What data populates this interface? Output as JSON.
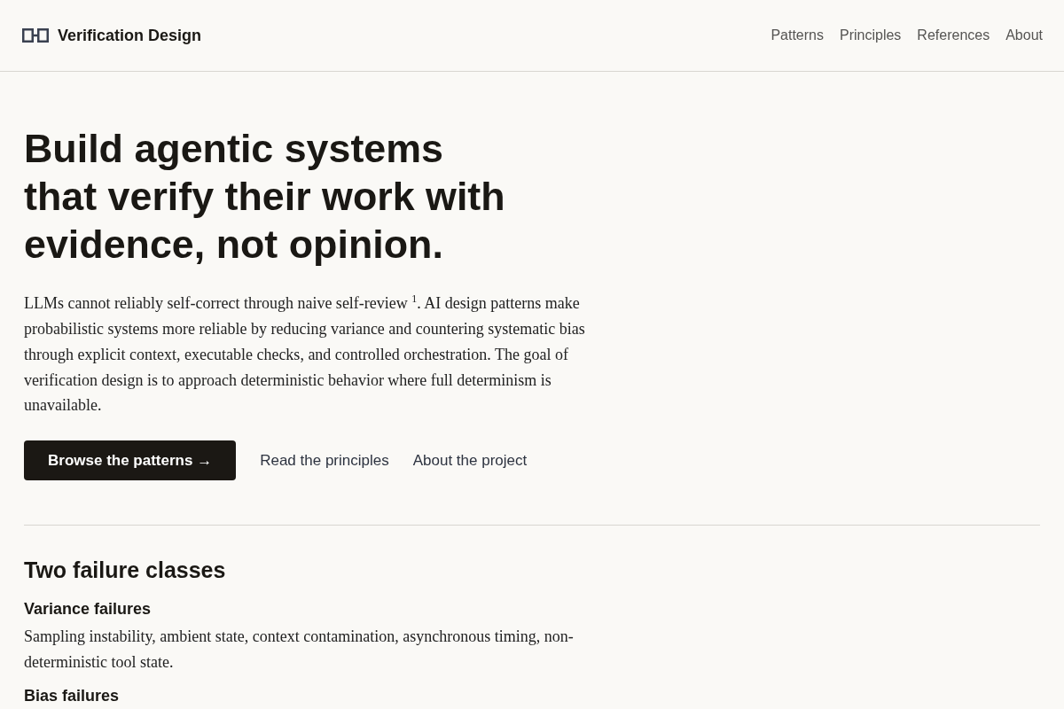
{
  "header": {
    "brand": "Verification Design",
    "nav": [
      {
        "label": "Patterns"
      },
      {
        "label": "Principles"
      },
      {
        "label": "References"
      },
      {
        "label": "About"
      }
    ]
  },
  "hero": {
    "title_lines": [
      "Build agentic systems",
      "that verify their work with evidence, not opinion."
    ],
    "intro": "LLMs cannot reliably self-correct through naive self-review $^{1}$. AI design patterns make probabilistic systems more reliable by reducing variance and countering systematic bias through explicit context, executable checks, and controlled orchestration. The goal of verification design is to approach deterministic behavior where full determinism is unavailable.",
    "actions": [
      {
        "kind": "primary",
        "label": "Browse the patterns →"
      },
      {
        "kind": "link",
        "label": "Read the principles"
      },
      {
        "kind": "link",
        "label": "About the project"
      }
    ]
  },
  "failure_section": {
    "title": "Two failure classes",
    "classes": [
      {
        "title": "Variance failures",
        "description": "Sampling instability, ambient state, context contamination, asynchronous timing, non-deterministic tool state."
      },
      {
        "title": "Bias failures"
      }
    ]
  }
}
